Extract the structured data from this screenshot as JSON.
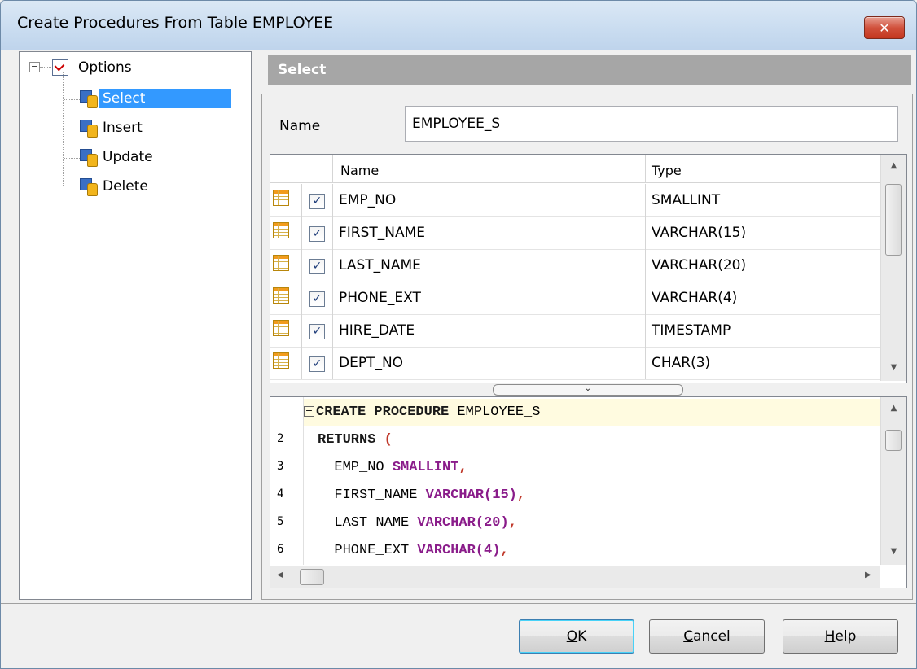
{
  "window": {
    "title": "Create Procedures From Table EMPLOYEE",
    "close_glyph": "✕"
  },
  "tree": {
    "root": {
      "label": "Options",
      "expander": "−"
    },
    "items": [
      {
        "label": "Select",
        "selected": true
      },
      {
        "label": "Insert",
        "selected": false
      },
      {
        "label": "Update",
        "selected": false
      },
      {
        "label": "Delete",
        "selected": false
      }
    ]
  },
  "section": {
    "title": "Select"
  },
  "name_field": {
    "label": "Name",
    "value": "EMPLOYEE_S"
  },
  "grid": {
    "headers": {
      "name": "Name",
      "type": "Type"
    },
    "rows": [
      {
        "checked": "✓",
        "name": "EMP_NO",
        "type": "SMALLINT"
      },
      {
        "checked": "✓",
        "name": "FIRST_NAME",
        "type": "VARCHAR(15)"
      },
      {
        "checked": "✓",
        "name": "LAST_NAME",
        "type": "VARCHAR(20)"
      },
      {
        "checked": "✓",
        "name": "PHONE_EXT",
        "type": "VARCHAR(4)"
      },
      {
        "checked": "✓",
        "name": "HIRE_DATE",
        "type": "TIMESTAMP"
      },
      {
        "checked": "✓",
        "name": "DEPT_NO",
        "type": "CHAR(3)"
      }
    ]
  },
  "editor": {
    "lines": [
      {
        "num": "",
        "fold": "−",
        "kw": "CREATE PROCEDURE",
        "text": " EMPLOYEE_S",
        "type": "",
        "punct": ""
      },
      {
        "num": "2",
        "fold": "",
        "kw": "RETURNS",
        "text": " ",
        "type": "",
        "punct": "("
      },
      {
        "num": "3",
        "fold": "",
        "kw": "",
        "text": "  EMP_NO ",
        "type": "SMALLINT",
        "punct": ","
      },
      {
        "num": "4",
        "fold": "",
        "kw": "",
        "text": "  FIRST_NAME ",
        "type": "VARCHAR(15)",
        "punct": ","
      },
      {
        "num": "5",
        "fold": "",
        "kw": "",
        "text": "  LAST_NAME ",
        "type": "VARCHAR(20)",
        "punct": ","
      },
      {
        "num": "6",
        "fold": "",
        "kw": "",
        "text": "  PHONE_EXT ",
        "type": "VARCHAR(4)",
        "punct": ","
      }
    ]
  },
  "buttons": {
    "ok": {
      "mnemonic": "O",
      "rest": "K"
    },
    "cancel": {
      "mnemonic": "C",
      "rest": "ancel"
    },
    "help": {
      "mnemonic": "H",
      "rest": "elp"
    }
  },
  "colors": {
    "selection": "#3399ff",
    "header_gray": "#a6a6a6",
    "type_purple": "#8a1c8a",
    "punct_red": "#c0392b"
  }
}
